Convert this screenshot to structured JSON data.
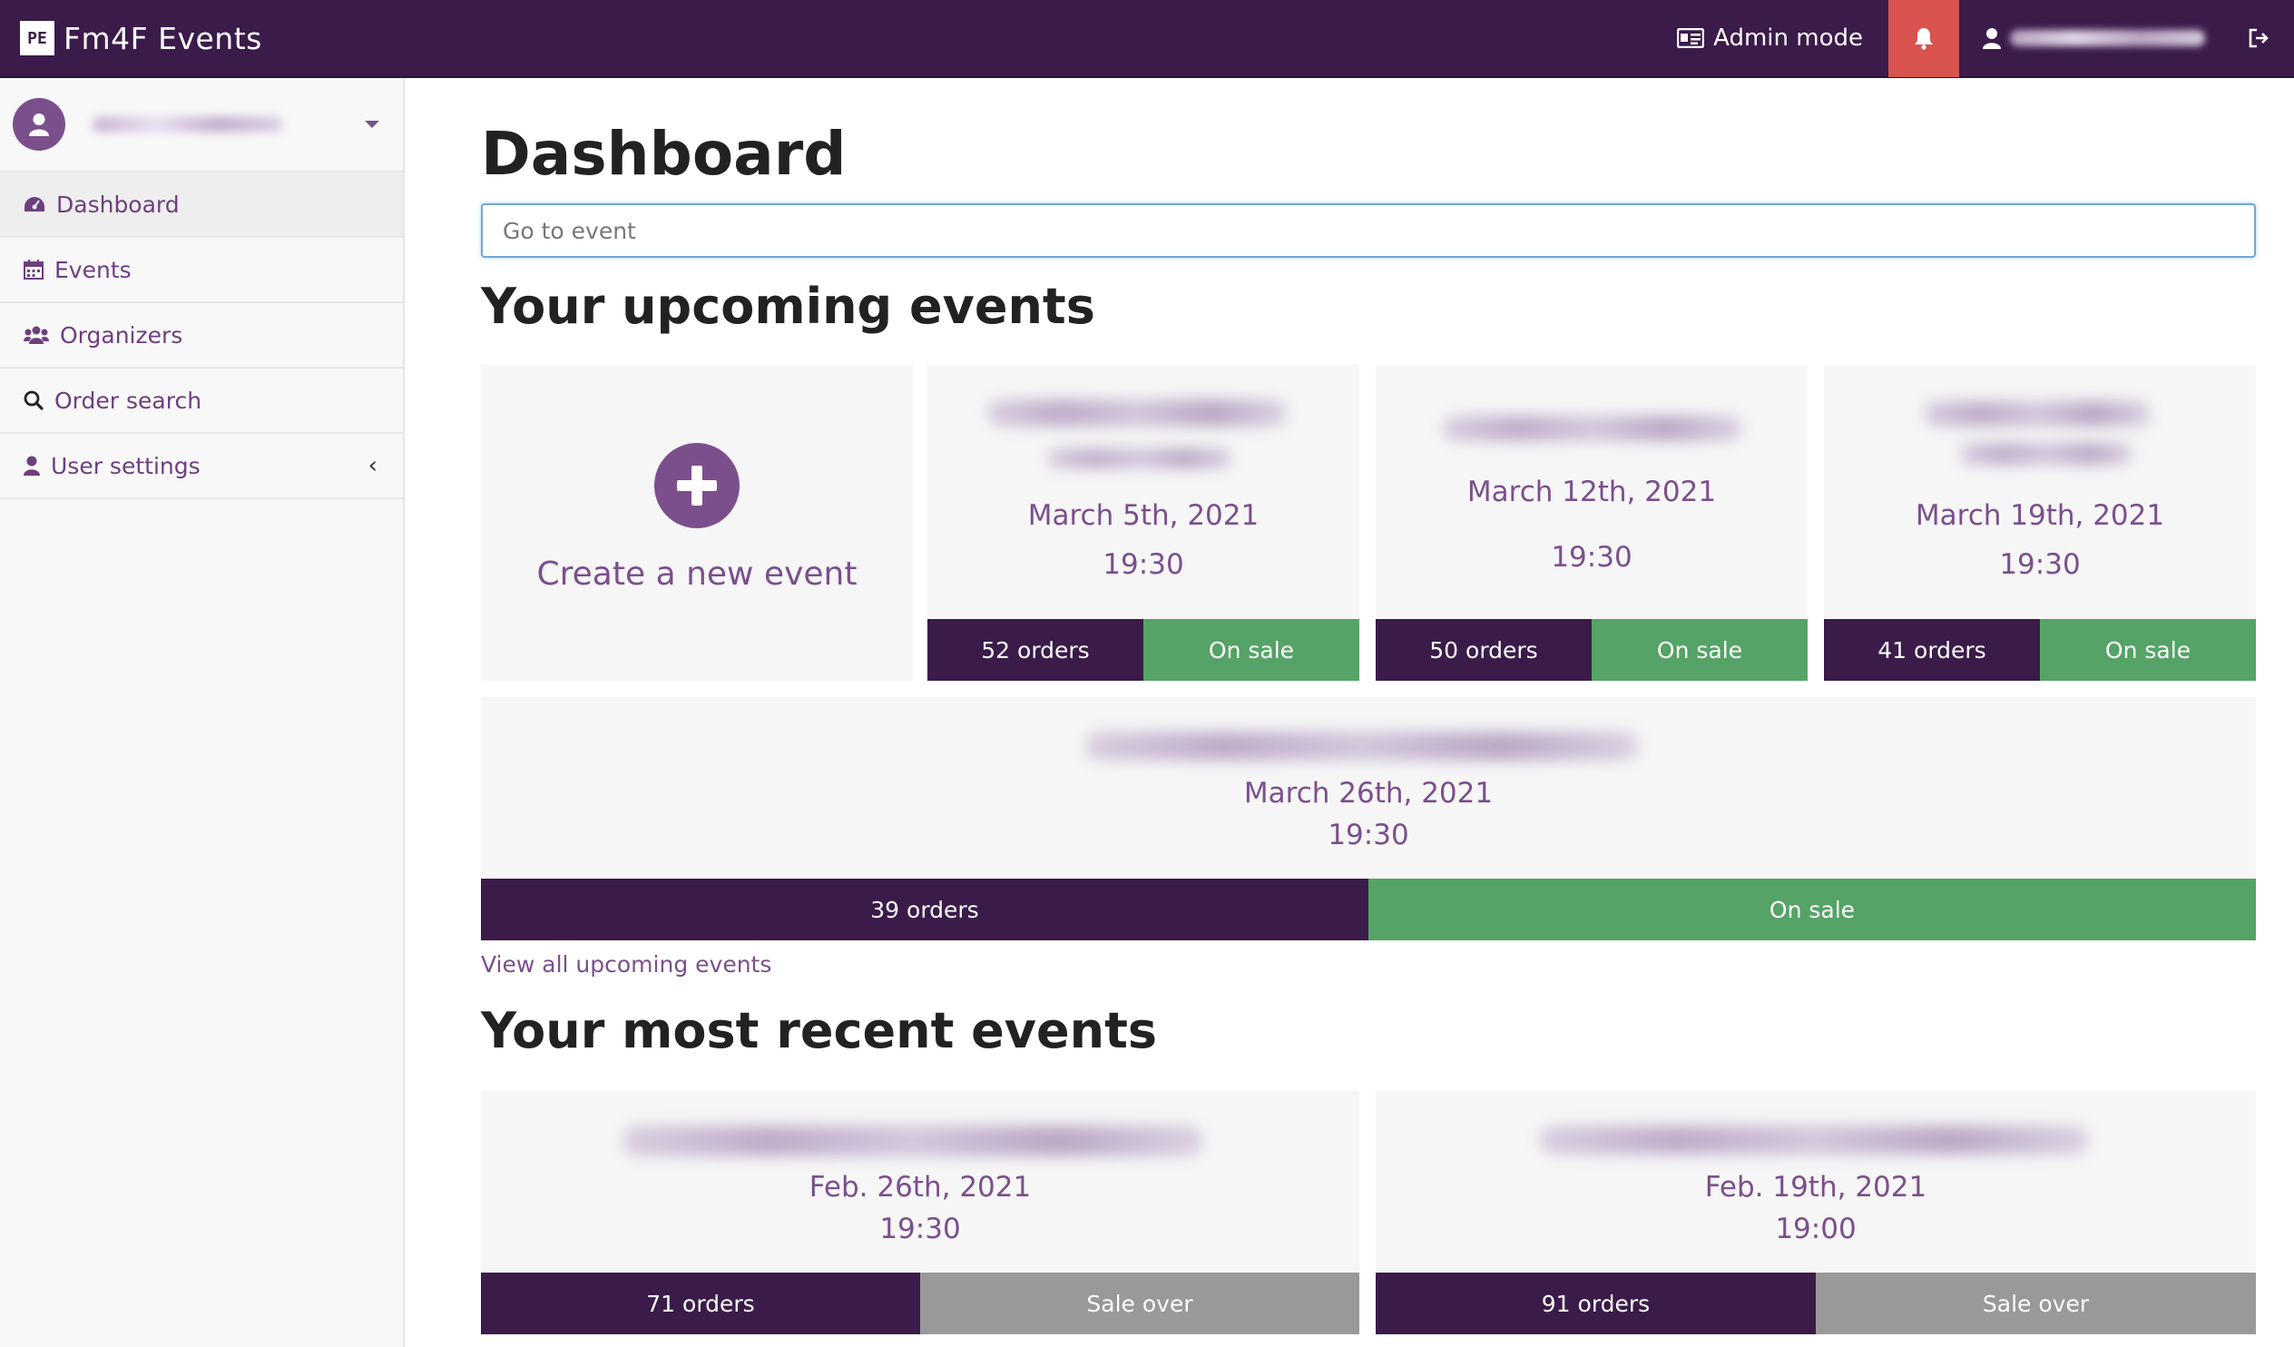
{
  "app": {
    "logo_text": "PE",
    "title": "Fm4F Events"
  },
  "topbar": {
    "admin_mode_label": "Admin mode",
    "bell_color": "#d9534f"
  },
  "sidebar": {
    "items": [
      {
        "label": "Dashboard",
        "icon": "dashboard-icon",
        "active": true
      },
      {
        "label": "Events",
        "icon": "calendar-icon"
      },
      {
        "label": "Organizers",
        "icon": "users-icon"
      },
      {
        "label": "Order search",
        "icon": "search-icon"
      },
      {
        "label": "User settings",
        "icon": "user-icon",
        "chevron": "‹"
      }
    ]
  },
  "main": {
    "title": "Dashboard",
    "search_placeholder": "Go to event",
    "upcoming_title": "Your upcoming events",
    "create_label": "Create a new event",
    "view_all_label": "View all upcoming events",
    "recent_title": "Your most recent events",
    "upcoming": [
      {
        "date": "March 5th, 2021",
        "time": "19:30",
        "orders": "52 orders",
        "status": "On sale"
      },
      {
        "date": "March 12th, 2021",
        "time": "19:30",
        "orders": "50 orders",
        "status": "On sale"
      },
      {
        "date": "March 19th, 2021",
        "time": "19:30",
        "orders": "41 orders",
        "status": "On sale"
      },
      {
        "date": "March 26th, 2021",
        "time": "19:30",
        "orders": "39 orders",
        "status": "On sale"
      }
    ],
    "recent": [
      {
        "date": "Feb. 26th, 2021",
        "time": "19:30",
        "orders": "71 orders",
        "status": "Sale over"
      },
      {
        "date": "Feb. 19th, 2021",
        "time": "19:00",
        "orders": "91 orders",
        "status": "Sale over"
      }
    ]
  },
  "colors": {
    "brand": "#3b1b4a",
    "accent": "#7b4f8c",
    "on_sale": "#55a366",
    "sale_over": "#999999"
  }
}
